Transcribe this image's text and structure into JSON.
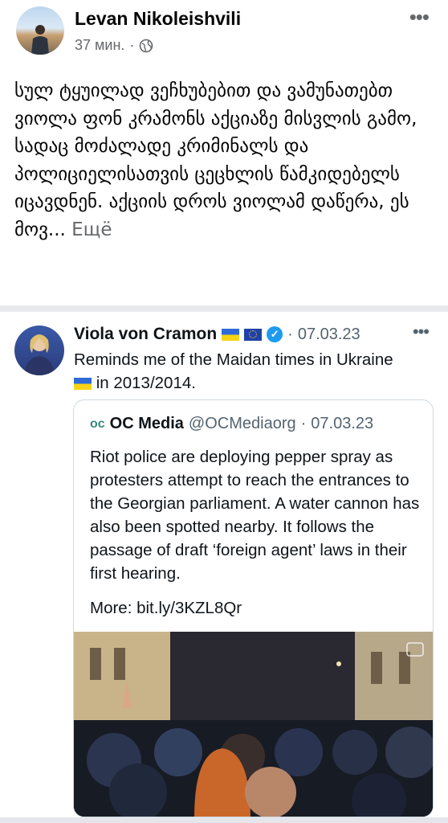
{
  "post": {
    "author": "Levan Nikoleishvili",
    "time": "37 мин.",
    "separator": "·",
    "text": "სულ ტყუილად ვეჩხუბებით და ვამუნათებთ ვიოლა ფონ კრამონს აქციაზე მისვლის გამო, სადაც მოძალადე კრიმინალს და პოლიციელისათვის ცეცხლის წამკიდებელს იცავდნენ. აქციის დროს ვიოლამ დაწერა, ეს მოვ...",
    "see_more": "Ещё",
    "more_dots": "•••"
  },
  "tweet": {
    "name": "Viola von Cramon",
    "separator": "·",
    "date": "07.03.23",
    "more_dots": "•••",
    "text_line1": "Reminds me of the Maidan times in Ukraine",
    "text_line2": "in 2013/2014.",
    "quote": {
      "logo": "oc",
      "name": "OC Media",
      "handle": "@OCMediaorg",
      "separator": "·",
      "date": "07.03.23",
      "text": "Riot police are deploying pepper spray as protesters attempt to reach the entrances to the Georgian parliament. A water cannon has also been spotted nearby. It follows the passage of draft ‘foreign agent’ laws in their first hearing.",
      "more": "More: bit.ly/3KZL8Qr"
    }
  },
  "icons": {
    "globe": "globe-icon",
    "verified": "verified-badge-icon",
    "flags": [
      "ukraine-flag-icon",
      "eu-flag-icon"
    ],
    "media": "gif-media-icon"
  },
  "colors": {
    "secondary_text": "#65676b",
    "twitter_blue": "#1d9bf0",
    "divider": "#e8e9ec"
  }
}
